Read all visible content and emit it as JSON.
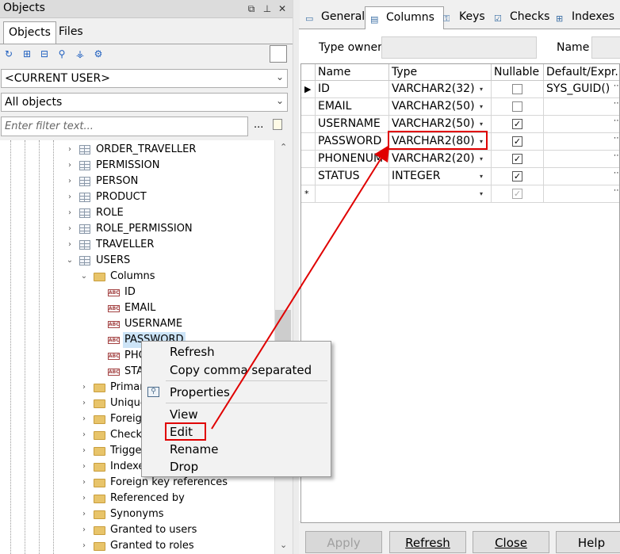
{
  "objects_panel": {
    "title": "Objects",
    "tabs": [
      "Objects",
      "Files"
    ],
    "owner_select": "<CURRENT USER>",
    "type_select": "All objects",
    "filter_placeholder": "Enter filter text...",
    "filter_more": "..."
  },
  "tree": {
    "items": [
      {
        "label": "ORDER_TRAVELLER",
        "kind": "table"
      },
      {
        "label": "PERMISSION",
        "kind": "table"
      },
      {
        "label": "PERSON",
        "kind": "table"
      },
      {
        "label": "PRODUCT",
        "kind": "table"
      },
      {
        "label": "ROLE",
        "kind": "table"
      },
      {
        "label": "ROLE_PERMISSION",
        "kind": "table"
      },
      {
        "label": "TRAVELLER",
        "kind": "table"
      },
      {
        "label": "USERS",
        "kind": "table"
      },
      {
        "label": "Columns",
        "kind": "folder"
      },
      {
        "label": "ID",
        "kind": "column"
      },
      {
        "label": "EMAIL",
        "kind": "column"
      },
      {
        "label": "USERNAME",
        "kind": "column"
      },
      {
        "label": "PASSWORD",
        "kind": "column"
      },
      {
        "label": "PHO",
        "kind": "column"
      },
      {
        "label": "STA",
        "kind": "column"
      },
      {
        "label": "Primar",
        "kind": "folder"
      },
      {
        "label": "Unique",
        "kind": "folder"
      },
      {
        "label": "Foreign",
        "kind": "folder"
      },
      {
        "label": "Check",
        "kind": "folder"
      },
      {
        "label": "Trigge",
        "kind": "folder"
      },
      {
        "label": "Indexe",
        "kind": "folder"
      },
      {
        "label": "Foreign key references",
        "kind": "folder"
      },
      {
        "label": "Referenced by",
        "kind": "folder"
      },
      {
        "label": "Synonyms",
        "kind": "folder"
      },
      {
        "label": "Granted to users",
        "kind": "folder"
      },
      {
        "label": "Granted to roles",
        "kind": "folder"
      }
    ]
  },
  "context_menu": {
    "items": [
      "Refresh",
      "Copy comma separated",
      "Properties",
      "View",
      "Edit",
      "Rename",
      "Drop"
    ]
  },
  "editor": {
    "tabs": [
      "General",
      "Columns",
      "Keys",
      "Checks",
      "Indexes"
    ],
    "type_owner_label": "Type owner",
    "name_label": "Name",
    "grid_headers": [
      "Name",
      "Type",
      "Nullable",
      "Default/Expr."
    ],
    "rows": [
      {
        "name": "ID",
        "type": "VARCHAR2(32)",
        "nullable": false,
        "default": "SYS_GUID()"
      },
      {
        "name": "EMAIL",
        "type": "VARCHAR2(50)",
        "nullable": false,
        "default": ""
      },
      {
        "name": "USERNAME",
        "type": "VARCHAR2(50)",
        "nullable": true,
        "default": ""
      },
      {
        "name": "PASSWORD",
        "type": "VARCHAR2(80)",
        "nullable": true,
        "default": ""
      },
      {
        "name": "PHONENUM",
        "type": "VARCHAR2(20)",
        "nullable": true,
        "default": ""
      },
      {
        "name": "STATUS",
        "type": "INTEGER",
        "nullable": true,
        "default": ""
      }
    ],
    "new_row_marker": "*",
    "current_row_marker": "▶",
    "buttons": {
      "apply": "Apply",
      "refresh": "Refresh",
      "close": "Close",
      "help": "Help"
    }
  },
  "colors": {
    "highlight": "#e00000",
    "selection": "#cce4f7"
  }
}
